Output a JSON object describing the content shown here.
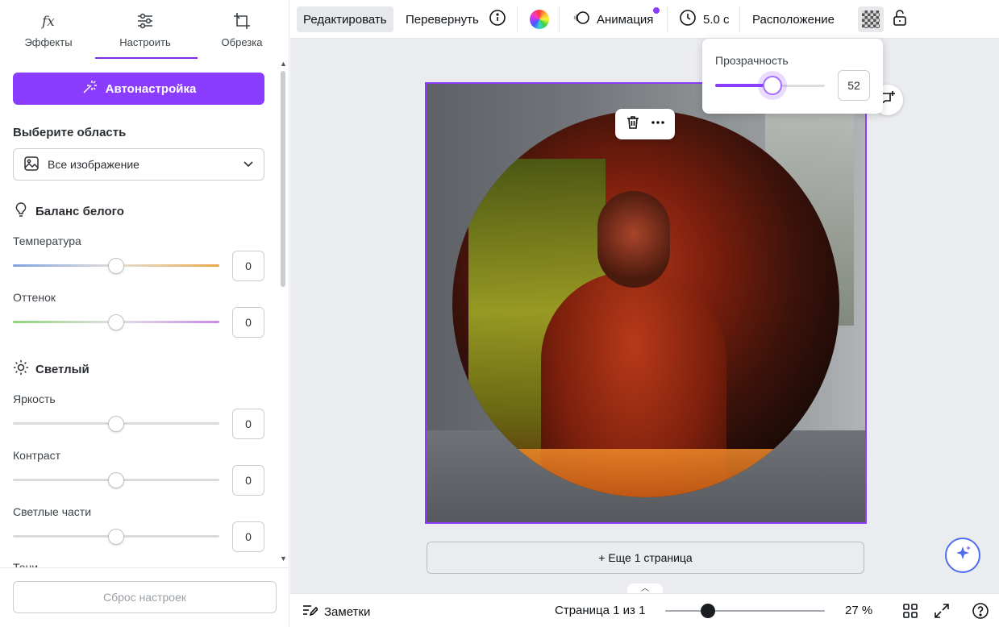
{
  "left_panel": {
    "tabs": [
      {
        "label": "Эффекты",
        "icon": "fx-icon"
      },
      {
        "label": "Настроить",
        "icon": "sliders-icon"
      },
      {
        "label": "Обрезка",
        "icon": "crop-icon"
      }
    ],
    "active_tab": "Настроить",
    "auto_button": "Автонастройка",
    "area_title": "Выберите область",
    "area_select": "Все изображение",
    "white_balance": {
      "title": "Баланс белого",
      "sliders": [
        {
          "label": "Температура",
          "value": "0"
        },
        {
          "label": "Оттенок",
          "value": "0"
        }
      ]
    },
    "light": {
      "title": "Светлый",
      "sliders": [
        {
          "label": "Яркость",
          "value": "0"
        },
        {
          "label": "Контраст",
          "value": "0"
        },
        {
          "label": "Светлые части",
          "value": "0"
        }
      ],
      "partial_label": "Тени"
    },
    "reset_button": "Сброс настроек"
  },
  "toolbar": {
    "edit": "Редактировать",
    "flip": "Перевернуть",
    "animation": "Анимация",
    "duration": "5.0 с",
    "position": "Расположение"
  },
  "transparency": {
    "title": "Прозрачность",
    "value": "52",
    "fraction": 0.52
  },
  "canvas": {
    "add_page": "+ Еще 1 страница"
  },
  "bottom_bar": {
    "notes": "Заметки",
    "page_indicator": "Страница 1 из 1",
    "zoom": "27 %",
    "zoom_fraction": 0.27
  },
  "colors": {
    "accent": "#8b3dff",
    "selection_border": "#8b3dff"
  }
}
